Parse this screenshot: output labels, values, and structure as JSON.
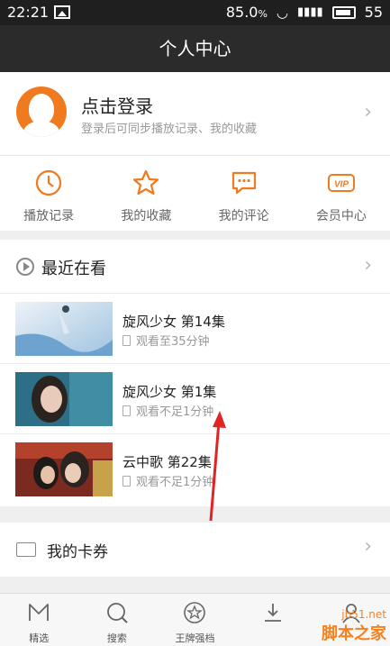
{
  "status": {
    "time": "22:21",
    "battery": "85.0",
    "battery_unit": "%",
    "extra": "55"
  },
  "nav": {
    "title": "个人中心"
  },
  "login": {
    "title": "点击登录",
    "subtitle": "登录后可同步播放记录、我的收藏"
  },
  "quick": [
    {
      "icon": "clock-icon",
      "label": "播放记录"
    },
    {
      "icon": "star-icon",
      "label": "我的收藏"
    },
    {
      "icon": "comment-icon",
      "label": "我的评论"
    },
    {
      "icon": "vip-icon",
      "label": "会员中心",
      "badge": "VIP"
    }
  ],
  "recent": {
    "title": "最近在看",
    "items": [
      {
        "name": "旋风少女 第14集",
        "progress": "观看至35分钟"
      },
      {
        "name": "旋风少女 第1集",
        "progress": "观看不足1分钟"
      },
      {
        "name": "云中歌 第22集",
        "progress": "观看不足1分钟"
      }
    ]
  },
  "cards": {
    "title": "我的卡券"
  },
  "tabs": [
    {
      "icon": "featured-icon",
      "label": "精选"
    },
    {
      "icon": "search-icon",
      "label": "搜索"
    },
    {
      "icon": "star-icon",
      "label": "王牌强档"
    },
    {
      "icon": "download-icon",
      "label": ""
    },
    {
      "icon": "user-icon",
      "label": ""
    }
  ],
  "watermark": {
    "site": "jb51.net",
    "brand": "脚本之家"
  },
  "colors": {
    "accent": "#f07a1f",
    "nav_bg": "#2b2b2b"
  }
}
